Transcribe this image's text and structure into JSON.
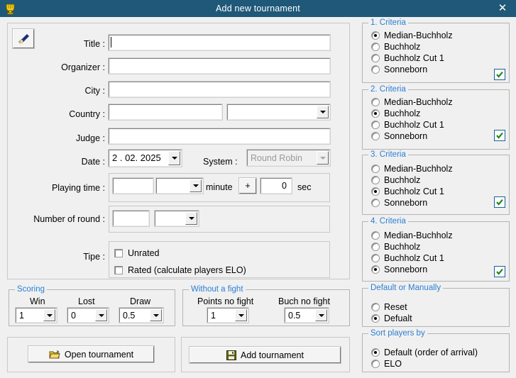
{
  "window": {
    "title": "Add new tournament",
    "icon": "trophy-icon",
    "close_label": "✕"
  },
  "toolbar": {
    "clear_icon": "brush-icon"
  },
  "form": {
    "fields": [
      {
        "label": "Title :",
        "value": "",
        "name": "title"
      },
      {
        "label": "Organizer :",
        "value": "",
        "name": "organizer"
      },
      {
        "label": "City :",
        "value": "",
        "name": "city"
      },
      {
        "label": "Country :",
        "value": "",
        "name": "country"
      },
      {
        "label": "Judge :",
        "value": "",
        "name": "judge"
      }
    ],
    "country_combo_value": "",
    "date": {
      "label": "Date :",
      "value": "2 . 02. 2025"
    },
    "system": {
      "label": "System :",
      "value": "Round Robin",
      "disabled": true
    },
    "playing_time": {
      "label": "Playing time :",
      "minutes_value": "",
      "minutes_combo_value": "",
      "minute_unit": "minute",
      "plus_label": "+",
      "seconds_value": "0",
      "sec_unit": "sec"
    },
    "number_of_round": {
      "label": "Number of round :",
      "value": "",
      "combo_value": ""
    },
    "tipe": {
      "label": "Tipe :",
      "options": [
        {
          "label": "Unrated",
          "checked": false
        },
        {
          "label": "Rated (calculate players ELO)",
          "checked": false
        }
      ]
    }
  },
  "scoring": {
    "group_label": "Scoring",
    "items": [
      {
        "label": "Win",
        "value": "1"
      },
      {
        "label": "Lost",
        "value": "0"
      },
      {
        "label": "Draw",
        "value": "0.5"
      }
    ]
  },
  "without_fight": {
    "group_label": "Without a fight",
    "items": [
      {
        "label": "Points no fight",
        "value": "1"
      },
      {
        "label": "Buch no fight",
        "value": "0.5"
      }
    ]
  },
  "actions": {
    "open": {
      "label": "Open tournament",
      "icon": "folder-open-icon"
    },
    "add": {
      "label": "Add tournament",
      "icon": "floppy-save-icon"
    }
  },
  "criteria": [
    {
      "group_label": "1. Criteria",
      "options": [
        "Median-Buchholz",
        "Buchholz",
        "Buchholz Cut 1",
        "Sonneborn"
      ],
      "selected": 0,
      "enabled_check": true
    },
    {
      "group_label": "2. Criteria",
      "options": [
        "Median-Buchholz",
        "Buchholz",
        "Buchholz Cut 1",
        "Sonneborn"
      ],
      "selected": 1,
      "enabled_check": true
    },
    {
      "group_label": "3. Criteria",
      "options": [
        "Median-Buchholz",
        "Buchholz",
        "Buchholz Cut 1",
        "Sonneborn"
      ],
      "selected": 2,
      "enabled_check": true
    },
    {
      "group_label": "4. Criteria",
      "options": [
        "Median-Buchholz",
        "Buchholz",
        "Buchholz Cut 1",
        "Sonneborn"
      ],
      "selected": 3,
      "enabled_check": true
    }
  ],
  "default_or_manually": {
    "group_label": "Default or Manually",
    "options": [
      "Reset",
      "Defualt"
    ],
    "selected": 1
  },
  "sort_players_by": {
    "group_label": "Sort players by",
    "options": [
      "Default (order of arrival)",
      "ELO"
    ],
    "selected": 0
  },
  "colors": {
    "titlebar": "#1f5878",
    "group_label": "#2b7fd4",
    "background": "#f0f0f0",
    "check_green": "#1f8a1f",
    "check_border": "#1b5e9e"
  }
}
